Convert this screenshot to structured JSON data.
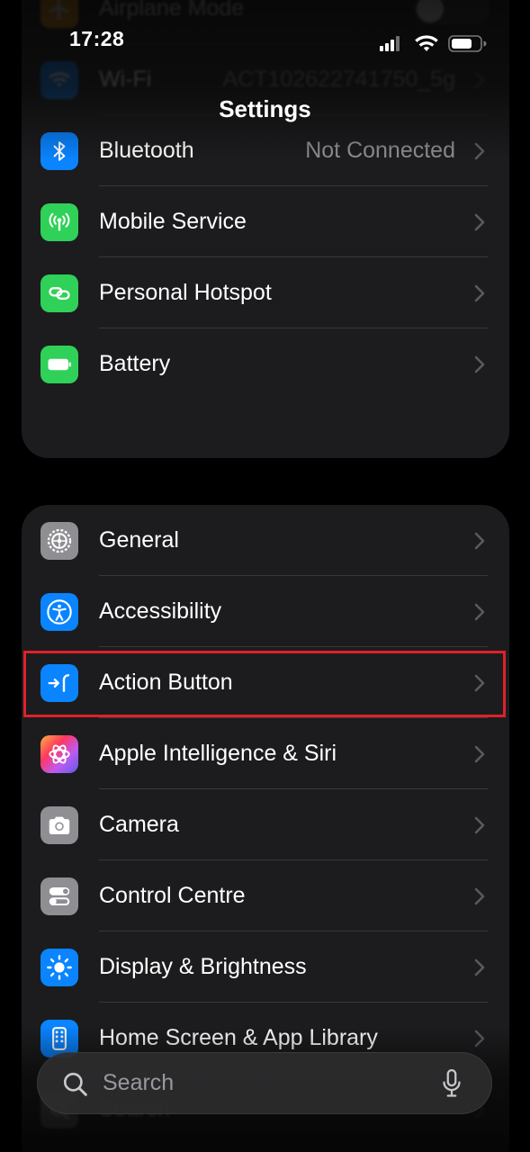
{
  "status_bar": {
    "time": "17:28"
  },
  "nav": {
    "title": "Settings"
  },
  "group1": [
    {
      "label": "Airplane Mode",
      "value": "",
      "icon": "airplane-icon",
      "color": "#ff9f0a",
      "faded": true
    },
    {
      "label": "Wi-Fi",
      "value": "ACT102622741750_5g",
      "icon": "wifi-icon",
      "color": "#0a84ff",
      "faded": true
    },
    {
      "label": "Bluetooth",
      "value": "Not Connected",
      "icon": "bluetooth-icon",
      "color": "#0a84ff"
    },
    {
      "label": "Mobile Service",
      "value": "",
      "icon": "antenna-icon",
      "color": "#30d158"
    },
    {
      "label": "Personal Hotspot",
      "value": "",
      "icon": "hotspot-link-icon",
      "color": "#30d158"
    },
    {
      "label": "Battery",
      "value": "",
      "icon": "battery-icon",
      "color": "#30d158"
    }
  ],
  "group2": [
    {
      "label": "General",
      "icon": "gear-icon",
      "color": "#8e8e93"
    },
    {
      "label": "Accessibility",
      "icon": "accessibility-icon",
      "color": "#0a84ff"
    },
    {
      "label": "Action Button",
      "icon": "action-button-icon",
      "color": "#0a84ff"
    },
    {
      "label": "Apple Intelligence & Siri",
      "icon": "siri-icon",
      "color": "#bf5af2"
    },
    {
      "label": "Camera",
      "icon": "camera-icon",
      "color": "#8e8e93"
    },
    {
      "label": "Control Centre",
      "icon": "toggles-icon",
      "color": "#8e8e93"
    },
    {
      "label": "Display & Brightness",
      "icon": "sun-icon",
      "color": "#0a84ff"
    },
    {
      "label": "Home Screen & App Library",
      "icon": "phone-grid-icon",
      "color": "#0a84ff"
    },
    {
      "label": "Search",
      "icon": "magnifier-icon",
      "color": "#8e8e93",
      "faded": true
    }
  ],
  "search": {
    "placeholder": "Search"
  }
}
